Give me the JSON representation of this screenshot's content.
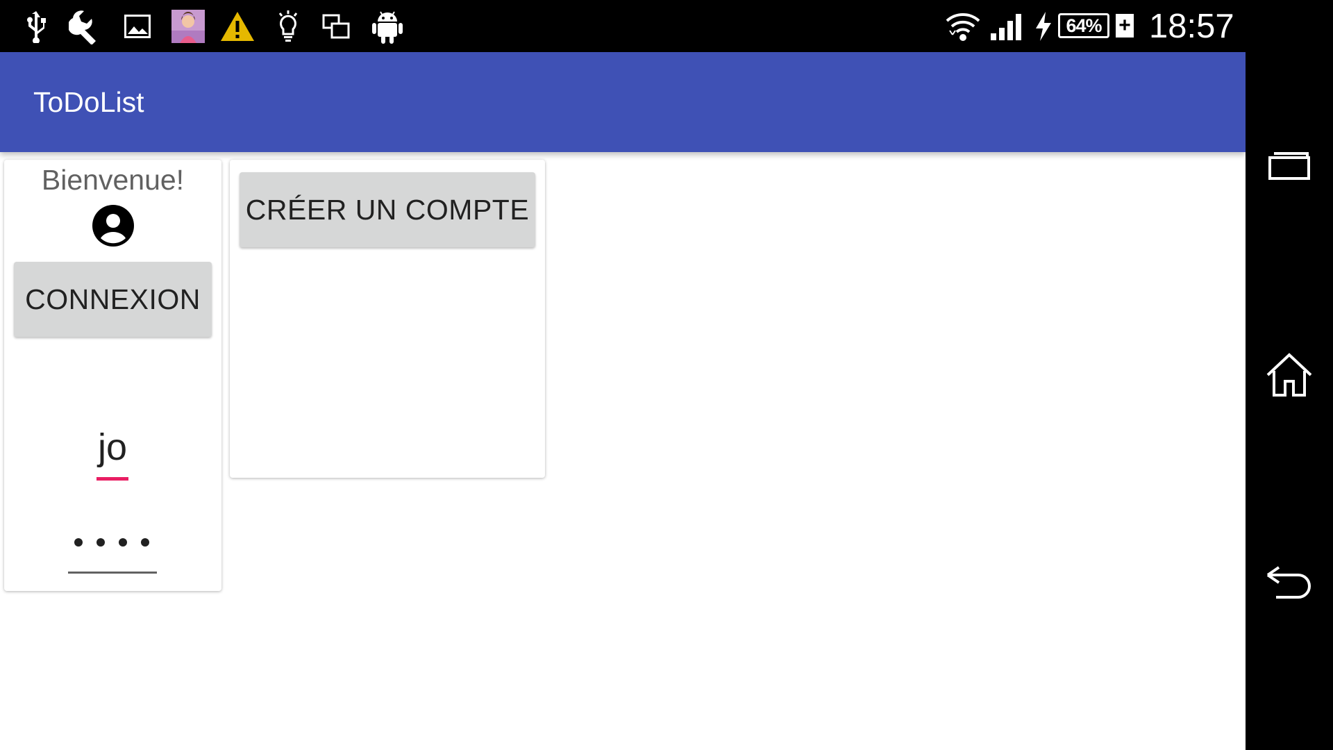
{
  "status_bar": {
    "left_icons": [
      "usb-icon",
      "wrench-icon",
      "image-icon",
      "avatar-notification-icon",
      "warning-icon",
      "lightbulb-icon",
      "screens-icon",
      "android-icon"
    ],
    "right_icons": [
      "wifi-icon",
      "signal-icon",
      "charging-bolt-icon",
      "battery-icon"
    ],
    "battery_label": "64%",
    "battery_level": 0.64,
    "battery_plus": "+",
    "time": "18:57"
  },
  "app_bar": {
    "title": "ToDoList",
    "color": "#3f51b5"
  },
  "login_card": {
    "welcome": "Bienvenue!",
    "avatar_icon": "account-circle-icon",
    "connexion_label": "CONNEXION",
    "username_value": "jo",
    "username_underline_color": "#e91e63",
    "password_masked": "••••",
    "password_length": 4
  },
  "create_card": {
    "create_account_label": "CRÉER UN COMPTE"
  },
  "nav_bar": {
    "buttons": [
      "recent-apps-icon",
      "home-icon",
      "back-icon"
    ]
  }
}
